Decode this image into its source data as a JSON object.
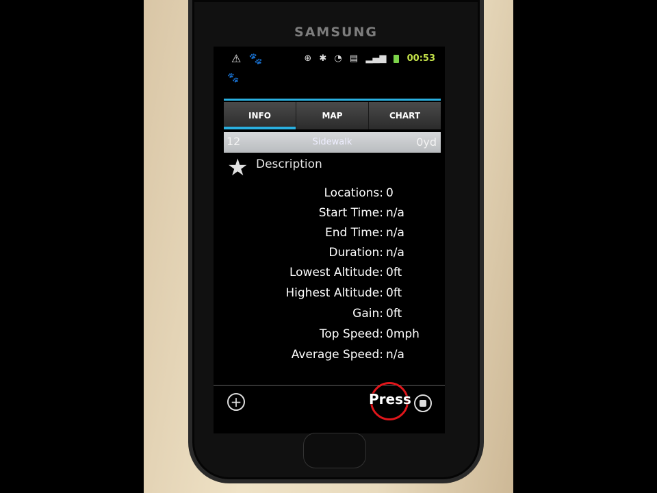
{
  "device": {
    "brand": "SAMSUNG"
  },
  "status_bar": {
    "time": "00:53",
    "icons_left": [
      "warning-icon",
      "paw-icon"
    ],
    "icons_right": [
      "gps-icon",
      "bluetooth-icon",
      "wifi-icon",
      "sim-icon",
      "signal-icon",
      "battery-icon"
    ]
  },
  "tabs": [
    {
      "label": "INFO",
      "active": true
    },
    {
      "label": "MAP",
      "active": false
    },
    {
      "label": "CHART",
      "active": false
    }
  ],
  "track": {
    "number": "12",
    "type": "Sidewalk",
    "distance": "0yd"
  },
  "description_title": "Description",
  "stats": [
    {
      "label": "Locations:",
      "value": "0"
    },
    {
      "label": "Start Time:",
      "value": "n/a"
    },
    {
      "label": "End Time:",
      "value": "n/a"
    },
    {
      "label": "Duration:",
      "value": "n/a"
    },
    {
      "label": "Lowest Altitude:",
      "value": "0ft"
    },
    {
      "label": "Highest Altitude:",
      "value": "0ft"
    },
    {
      "label": "Gain:",
      "value": "0ft"
    },
    {
      "label": "Top Speed:",
      "value": "0mph"
    },
    {
      "label": "Average Speed:",
      "value": "n/a"
    }
  ],
  "annotation": {
    "label": "Press",
    "color": "#e0161b"
  },
  "colors": {
    "accent": "#2ab0e0",
    "clock": "#c6e44a"
  }
}
